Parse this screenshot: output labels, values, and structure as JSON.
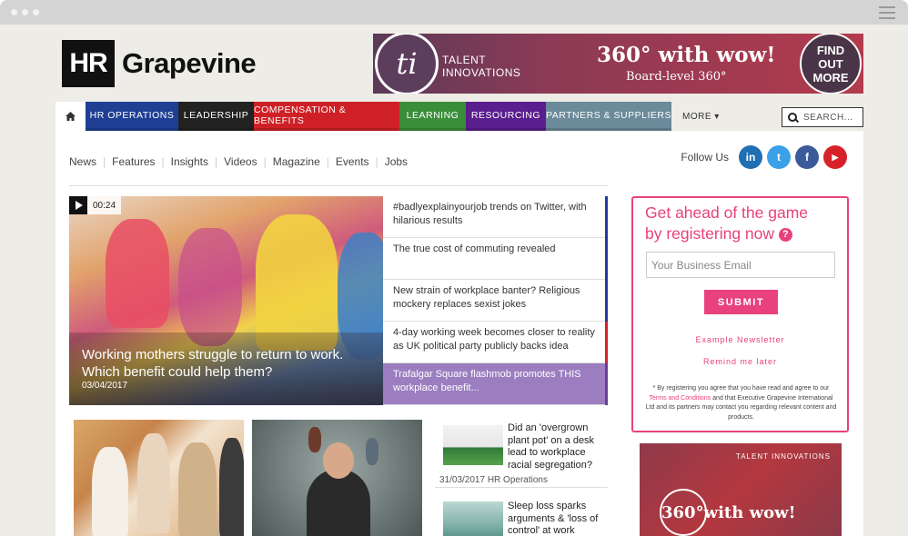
{
  "site": {
    "logo_hr": "HR",
    "logo_name": "Grapevine"
  },
  "banner": {
    "ti_mark": "ti",
    "brand_line1": "TALENT",
    "brand_line2": "INNOVATIONS",
    "headline": "360° with wow!",
    "subline": "Board-level 360°",
    "cta_line1": "FIND",
    "cta_line2": "OUT",
    "cta_line3": "MORE"
  },
  "nav": {
    "home_icon": "home-icon",
    "items": [
      {
        "label": "HR OPERATIONS",
        "color": "#1f3f95"
      },
      {
        "label": "LEADERSHIP",
        "color": "#222222"
      },
      {
        "label": "COMPENSATION & BENEFITS",
        "color": "#cf2027"
      },
      {
        "label": "LEARNING",
        "color": "#3a8e3a"
      },
      {
        "label": "RESOURCING",
        "color": "#5b1e8e"
      },
      {
        "label": "PARTNERS & SUPPLIERS",
        "color": "#6b8a9a"
      }
    ],
    "more_label": "MORE ▾",
    "search_placeholder": "SEARCH..."
  },
  "subnav": {
    "items": [
      "News",
      "Features",
      "Insights",
      "Videos",
      "Magazine",
      "Events",
      "Jobs"
    ],
    "sep": "|"
  },
  "social": {
    "label": "Follow Us",
    "icons": [
      {
        "name": "linkedin-icon",
        "glyph": "in",
        "color": "#1f6fb2"
      },
      {
        "name": "twitter-icon",
        "glyph": "t",
        "color": "#3aa0e8"
      },
      {
        "name": "facebook-icon",
        "glyph": "f",
        "color": "#3b5a99"
      },
      {
        "name": "youtube-icon",
        "glyph": "▶",
        "color": "#d8222a"
      }
    ]
  },
  "hero": {
    "video_time": "00:24",
    "title": "Working mothers struggle to return to work. Which benefit could help them?",
    "date": "03/04/2017"
  },
  "stories": [
    "#badlyexplainyourjob trends on Twitter, with hilarious results",
    "The true cost of commuting revealed",
    "New strain of workplace banter? Religious mockery replaces sexist jokes",
    "4-day working week becomes closer to reality as UK political party publicly backs idea",
    "Trafalgar Square flashmob promotes THIS workplace benefit..."
  ],
  "register": {
    "heading_line1": "Get ahead of the game",
    "heading_line2": "by registering now",
    "help_icon": "?",
    "email_placeholder": "Your Business Email",
    "submit_label": "SUBMIT",
    "example_link": "Example Newsletter",
    "remind_link": "Remind me later",
    "fine_print_1": "* By registering you agree that you have read and agree to our ",
    "fine_print_link": "Terms and Conditions",
    "fine_print_2": " and that Executive Grapevine International Ltd and its partners may contact you regarding relevant content and products."
  },
  "minis": [
    {
      "title": "Did an 'overgrown plant pot' on a desk lead to workplace racial segregation?",
      "meta": "31/03/2017 HR Operations"
    },
    {
      "title": "Sleep loss sparks arguments & 'loss of control' at work",
      "meta": ""
    }
  ],
  "ad2": {
    "label": "TALENT INNOVATIONS",
    "headline": "360°with wow!"
  }
}
